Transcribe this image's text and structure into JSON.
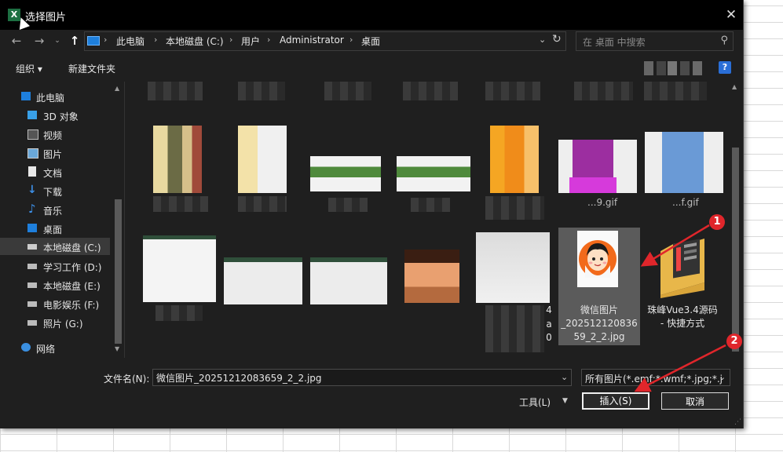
{
  "window": {
    "title": "选择图片",
    "app_icon": "X"
  },
  "nav": {
    "breadcrumb": [
      "此电脑",
      "本地磁盘 (C:)",
      "用户",
      "Administrator",
      "桌面"
    ],
    "search_placeholder": "在 桌面 中搜索"
  },
  "toolbar": {
    "organize": "组织 ▾",
    "new_folder": "新建文件夹",
    "help": "?"
  },
  "sidebar": {
    "items": [
      {
        "label": "此电脑",
        "icon": "computer-icon"
      },
      {
        "label": "3D 对象",
        "icon": "cube-icon"
      },
      {
        "label": "视频",
        "icon": "video-icon"
      },
      {
        "label": "图片",
        "icon": "picture-icon"
      },
      {
        "label": "文档",
        "icon": "document-icon"
      },
      {
        "label": "下载",
        "icon": "download-icon"
      },
      {
        "label": "音乐",
        "icon": "music-icon"
      },
      {
        "label": "桌面",
        "icon": "desktop-icon"
      },
      {
        "label": "本地磁盘 (C:)",
        "icon": "drive-icon"
      },
      {
        "label": "学习工作 (D:)",
        "icon": "drive-icon"
      },
      {
        "label": "本地磁盘 (E:)",
        "icon": "drive-icon"
      },
      {
        "label": "电影娱乐 (F:)",
        "icon": "drive-icon"
      },
      {
        "label": "照片 (G:)",
        "icon": "drive-icon"
      },
      {
        "label": "网络",
        "icon": "network-icon"
      }
    ]
  },
  "files": {
    "selected_name_lines": [
      "微信图片",
      "_202512120836",
      "59_2_2.jpg"
    ],
    "shortcut_name_lines": [
      "珠峰Vue3.4源码",
      "- 快捷方式"
    ],
    "partial_labels": [
      "...9.gif",
      "...f.gif"
    ],
    "edge_chars": [
      "4",
      "a",
      "0"
    ]
  },
  "annotations": {
    "marker1": "1",
    "marker2": "2"
  },
  "bottom": {
    "filename_label": "文件名(N):",
    "filename_value": "微信图片_20251212083659_2_2.jpg",
    "filter_value": "所有图片(*.emf;*.wmf;*.jpg;*.j",
    "tools_label": "工具(L)",
    "insert_button": "插入(S)",
    "cancel_button": "取消"
  },
  "colors": {
    "accent_red": "#e0262b",
    "dialog_bg": "#1f1f1f",
    "titlebar_bg": "#000000"
  }
}
